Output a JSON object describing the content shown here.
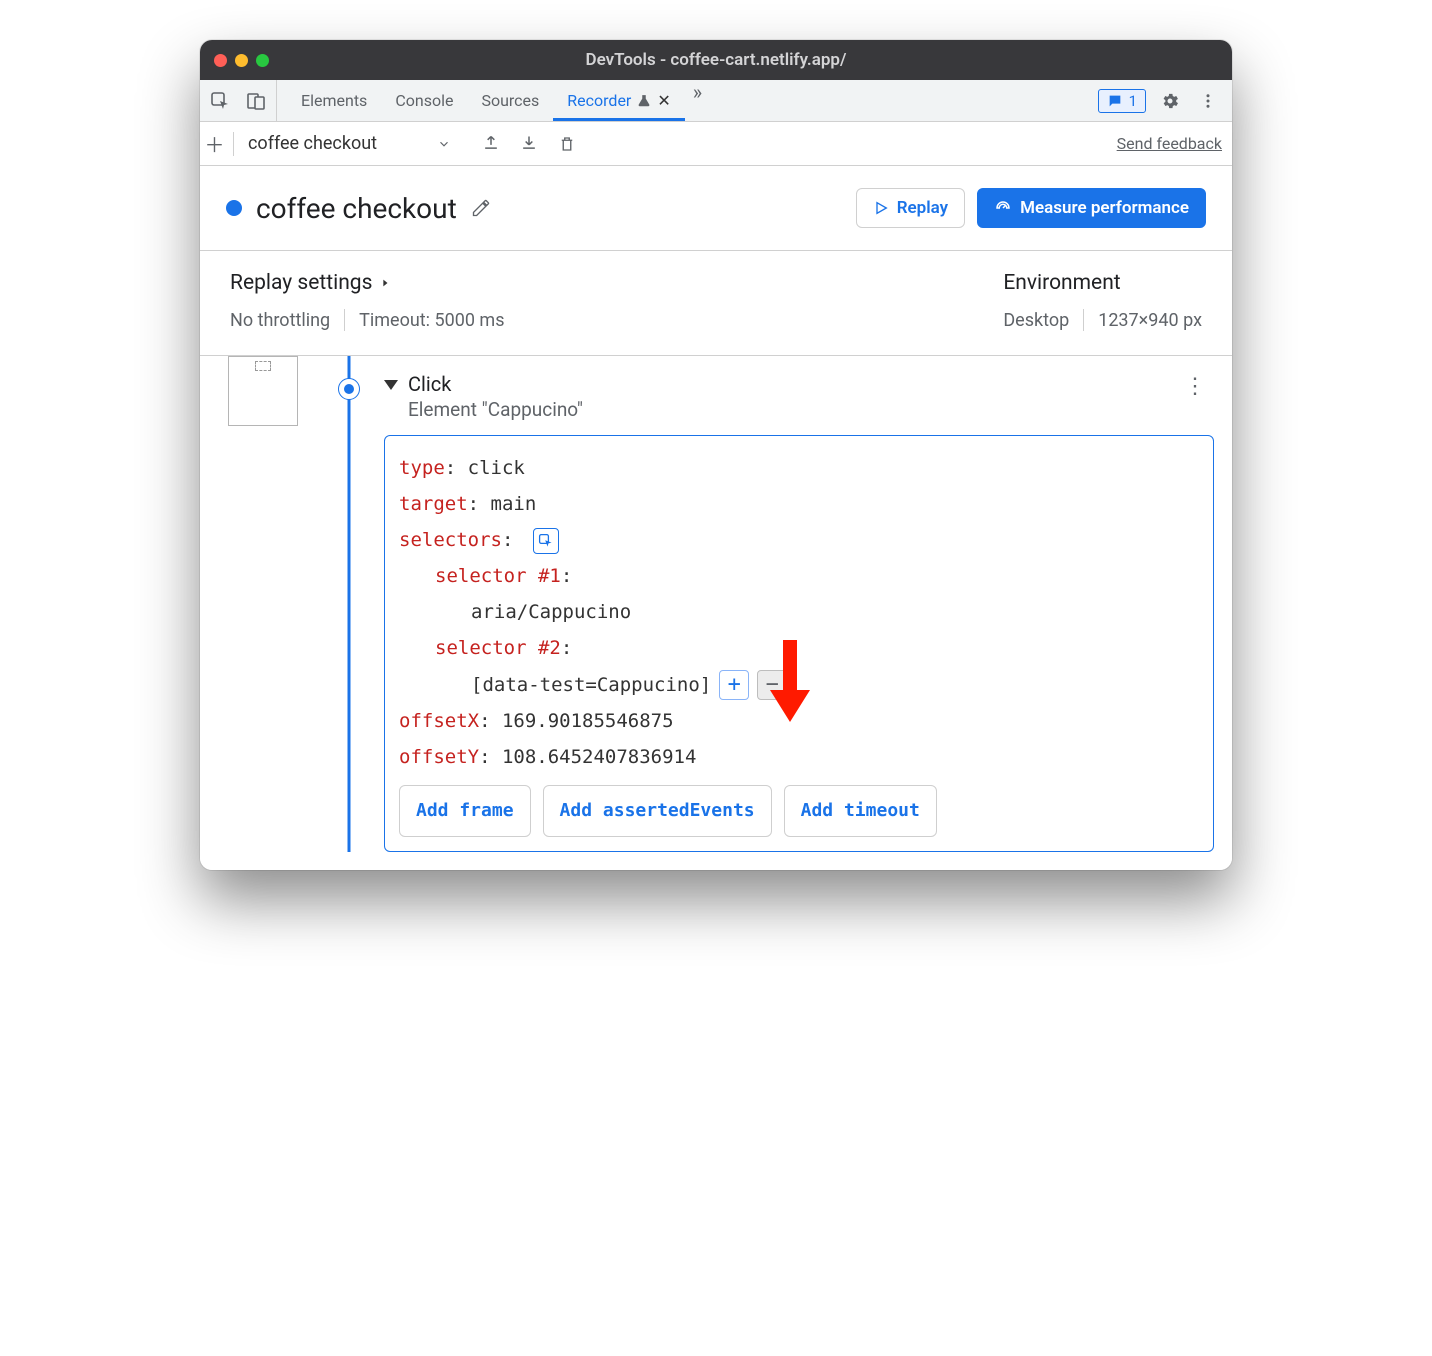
{
  "window": {
    "title": "DevTools - coffee-cart.netlify.app/"
  },
  "tabs": {
    "elements": "Elements",
    "console": "Console",
    "sources": "Sources",
    "recorder": "Recorder",
    "issues_count": "1"
  },
  "toolbar": {
    "recording_name": "coffee checkout",
    "feedback": "Send feedback"
  },
  "header": {
    "title": "coffee checkout",
    "replay": "Replay",
    "measure": "Measure performance"
  },
  "settings": {
    "replay_head": "Replay settings",
    "throttle": "No throttling",
    "timeout": "Timeout: 5000 ms",
    "env_head": "Environment",
    "device": "Desktop",
    "viewport": "1237×940 px"
  },
  "step": {
    "title": "Click",
    "subtitle": "Element \"Cappucino\"",
    "type_k": "type",
    "type_v": ": click",
    "target_k": "target",
    "target_v": ": main",
    "selectors_k": "selectors",
    "selectors_v": ":",
    "sel1_k": "selector #1",
    "sel1_v": ":",
    "sel1_body": "aria/Cappucino",
    "sel2_k": "selector #2",
    "sel2_v": ":",
    "sel2_body": "[data-test=Cappucino]",
    "offx_k": "offsetX",
    "offx_v": ": 169.90185546875",
    "offy_k": "offsetY",
    "offy_v": ": 108.6452407836914",
    "add_frame": "Add frame",
    "add_asserted": "Add assertedEvents",
    "add_timeout": "Add timeout"
  }
}
